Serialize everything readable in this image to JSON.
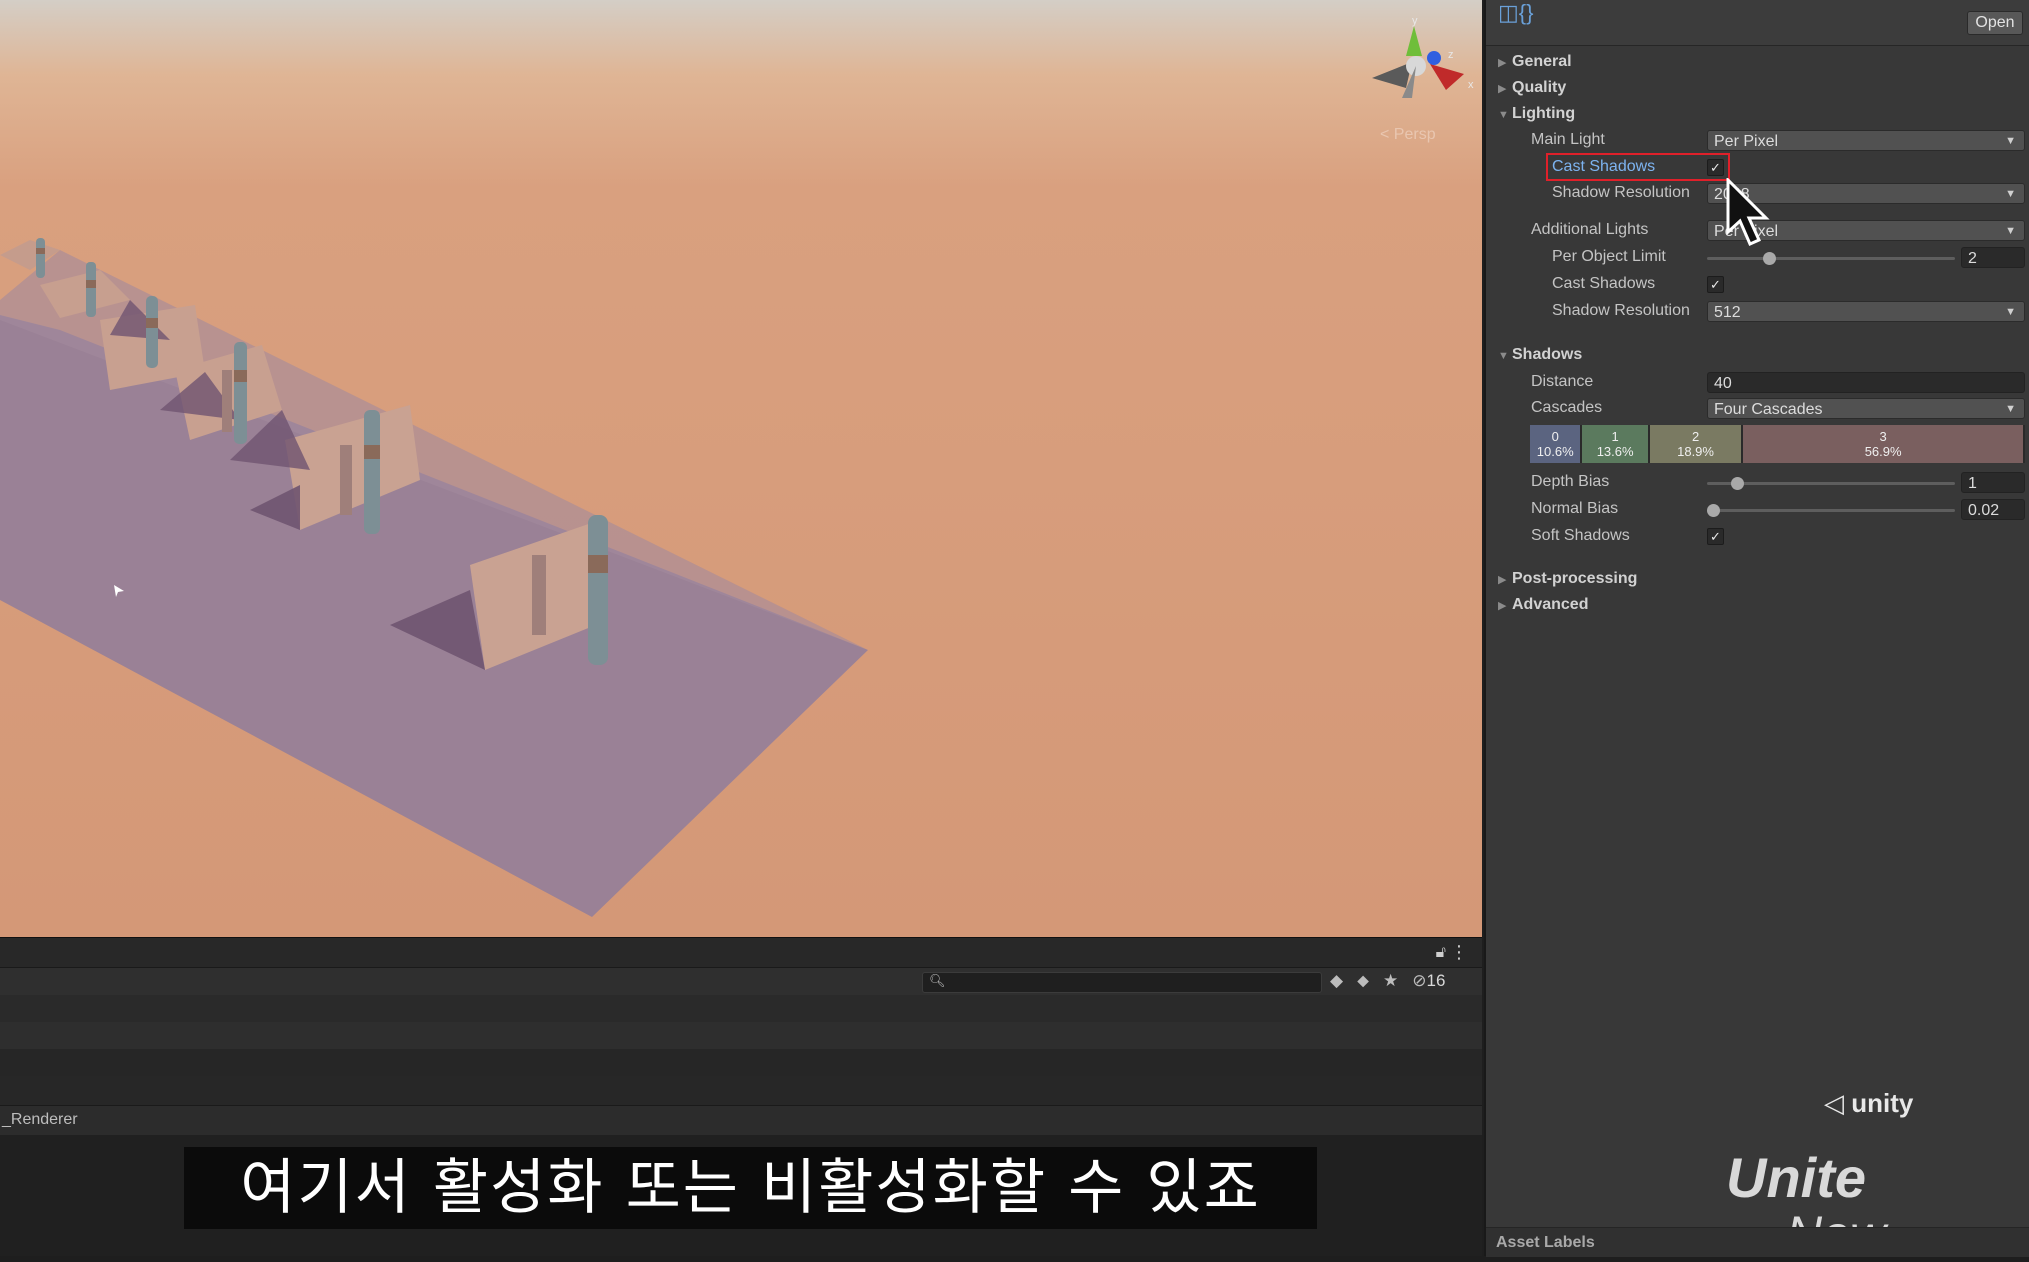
{
  "viewport": {
    "projection_label": "< Persp",
    "gizmo_axes": [
      "y",
      "z",
      "x"
    ]
  },
  "console": {
    "lock_icon": "lock-icon",
    "menu_icon": "kebab-menu-icon",
    "search_placeholder": "",
    "hidden_count": "16"
  },
  "renderer_label": "_Renderer",
  "subtitle": "여기서 활성화 또는 비활성화할 수 있죠",
  "inspector": {
    "open_button": "Open",
    "sections": {
      "general": "General",
      "quality": "Quality",
      "lighting": "Lighting",
      "shadows": "Shadows",
      "post_processing": "Post-processing",
      "advanced": "Advanced"
    },
    "lighting": {
      "main_light_label": "Main Light",
      "main_light_value": "Per Pixel",
      "cast_shadows_label": "Cast Shadows",
      "cast_shadows_checked": true,
      "shadow_resolution_label": "Shadow Resolution",
      "shadow_resolution_value": "2048",
      "additional_lights_label": "Additional Lights",
      "additional_lights_value": "Per Pixel",
      "per_object_limit_label": "Per Object Limit",
      "per_object_limit_value": "2",
      "per_object_limit_fraction": 0.25,
      "add_cast_shadows_label": "Cast Shadows",
      "add_cast_shadows_checked": true,
      "add_shadow_resolution_label": "Shadow Resolution",
      "add_shadow_resolution_value": "512"
    },
    "shadows": {
      "distance_label": "Distance",
      "distance_value": "40",
      "cascades_label": "Cascades",
      "cascades_value": "Four Cascades",
      "cascade_splits": [
        {
          "index": "0",
          "percent": "10.6%",
          "color": "#5b6480"
        },
        {
          "index": "1",
          "percent": "13.6%",
          "color": "#5b7a5e"
        },
        {
          "index": "2",
          "percent": "18.9%",
          "color": "#7a7a62"
        },
        {
          "index": "3",
          "percent": "56.9%",
          "color": "#7a5f5f"
        }
      ],
      "depth_bias_label": "Depth Bias",
      "depth_bias_value": "1",
      "normal_bias_label": "Normal Bias",
      "normal_bias_value": "0.02",
      "soft_shadows_label": "Soft Shadows",
      "soft_shadows_checked": true
    },
    "asset_labels": "Asset Labels"
  },
  "branding": {
    "unity": "unity",
    "unite": "Unite",
    "now": "Now"
  },
  "colors": {
    "highlight_border": "#e0202a",
    "cast_shadows_label": "#7db3f0"
  }
}
